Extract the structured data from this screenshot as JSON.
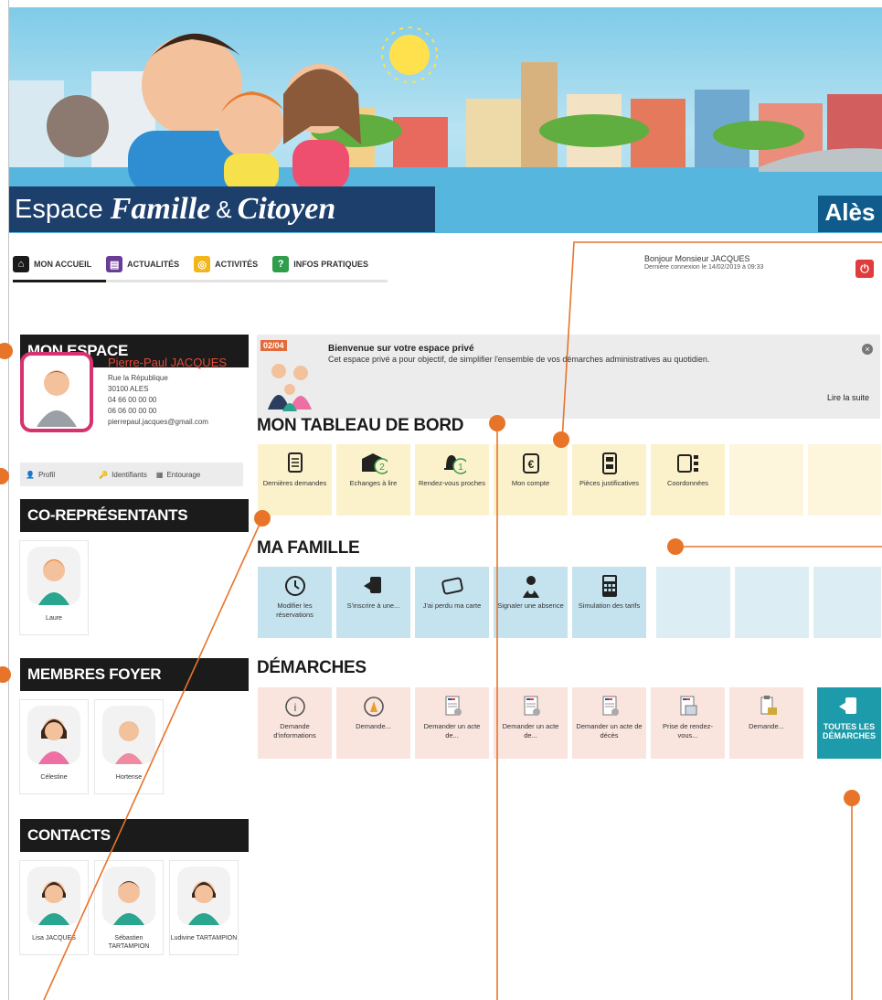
{
  "banner": {
    "title_1": "Espace",
    "title_2": "Famille",
    "title_amp": "&",
    "title_3": "Citoyen",
    "logo": "Alès"
  },
  "nav": [
    {
      "label": "MON ACCUEIL",
      "icon": "home-icon",
      "color": "#1a1a1a"
    },
    {
      "label": "ACTUALITÉS",
      "icon": "news-icon",
      "color": "#6a3c98"
    },
    {
      "label": "ACTIVITÉS",
      "icon": "activity-icon",
      "color": "#f2b51c"
    },
    {
      "label": "INFOS PRATIQUES",
      "icon": "info-icon",
      "color": "#2e9e4b"
    }
  ],
  "user": {
    "greeting": "Bonjour Monsieur JACQUES",
    "last_login": "Dernière connexion le 14/02/2019 à 09:33"
  },
  "sidebar": {
    "mon_espace": "MON ESPACE",
    "profile": {
      "name": "Pierre-Paul JACQUES",
      "address": "Rue la République",
      "city": "30100 ALES",
      "phone1": "04 66 00 00 00",
      "phone2": "06 06 00 00 00",
      "email": "pierrepaul.jacques@gmail.com"
    },
    "tabs": [
      "Profil",
      "Identifiants",
      "Entourage"
    ],
    "co_rep_title": "CO-REPRÉSENTANTS",
    "co_rep": [
      "Laure"
    ],
    "foyer_title": "MEMBRES FOYER",
    "foyer": [
      "Célestine",
      "Hortense"
    ],
    "contacts_title": "CONTACTS",
    "contacts": [
      "Lisa JACQUES",
      "Sébastien TARTAMPION",
      "Ludivine TARTAMPION"
    ]
  },
  "welcome": {
    "badge": "02/04",
    "title": "Bienvenue sur votre espace privé",
    "text": "Cet espace privé a pour objectif, de simplifier l'ensemble de vos démarches administratives au quotidien.",
    "more": "Lire la suite"
  },
  "tableau": {
    "title": "MON TABLEAU DE BORD",
    "tiles": [
      {
        "label": "Dernières demandes",
        "icon": "document-icon"
      },
      {
        "label": "Echanges à lire",
        "icon": "mail-icon",
        "badge": "2"
      },
      {
        "label": "Rendez-vous proches",
        "icon": "bell-icon",
        "badge": "1"
      },
      {
        "label": "Mon compte",
        "icon": "euro-icon"
      },
      {
        "label": "Pièces justificatives",
        "icon": "files-icon"
      },
      {
        "label": "Coordonnées",
        "icon": "contact-card-icon"
      }
    ]
  },
  "famille": {
    "title": "MA FAMILLE",
    "tiles": [
      {
        "label": "Modifier les réservations",
        "icon": "clock-icon"
      },
      {
        "label": "S'inscrire à une...",
        "icon": "signup-icon"
      },
      {
        "label": "J'ai perdu ma carte",
        "icon": "card-icon"
      },
      {
        "label": "Signaler une absence",
        "icon": "absence-icon"
      },
      {
        "label": "Simulation des tarifs",
        "icon": "calculator-icon"
      }
    ]
  },
  "demarches": {
    "title": "DÉMARCHES",
    "tiles": [
      {
        "label": "Demande d'informations",
        "icon": "info-circle-icon"
      },
      {
        "label": "Demande...",
        "icon": "cone-icon"
      },
      {
        "label": "Demander un acte de...",
        "icon": "certificate-icon"
      },
      {
        "label": "Demander un acte de...",
        "icon": "certificate-icon"
      },
      {
        "label": "Demander un acte de décès",
        "icon": "certificate-icon"
      },
      {
        "label": "Prise de rendez-vous...",
        "icon": "appointment-icon"
      },
      {
        "label": "Demande...",
        "icon": "clipboard-icon"
      }
    ],
    "all": "TOUTES LES DÉMARCHES"
  },
  "colors": {
    "accent": "#e8742a",
    "dark": "#1b1b1b",
    "yellow_tile": "#fbf1cb",
    "blue_tile": "#c5e3ee",
    "pink_tile": "#f9e4de",
    "teal": "#1e9baa"
  }
}
